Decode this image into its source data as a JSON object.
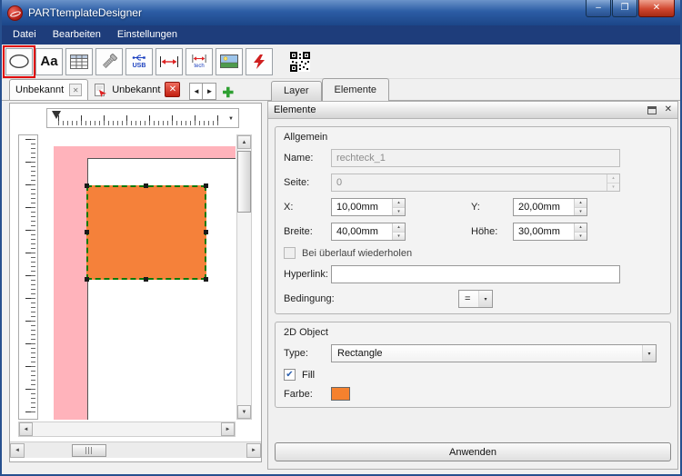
{
  "window": {
    "title": "PARTtemplateDesigner",
    "minimize_glyph": "–",
    "maximize_glyph": "❐",
    "close_glyph": "✕"
  },
  "menubar": {
    "items": [
      "Datei",
      "Bearbeiten",
      "Einstellungen"
    ]
  },
  "toolbar": {
    "text_tool_label": "Aa",
    "usb_label": "USB",
    "tech_label": "tech"
  },
  "doc_tabs": {
    "tab1_label": "Unbekannt",
    "tab2_label": "Unbekannt"
  },
  "panel_tabs": {
    "layer_label": "Layer",
    "elemente_label": "Elemente"
  },
  "dock": {
    "title": "Elemente",
    "allgemein": {
      "title": "Allgemein",
      "name_label": "Name:",
      "name_value": "rechteck_1",
      "seite_label": "Seite:",
      "seite_value": "0",
      "x_label": "X:",
      "x_value": "10,00mm",
      "y_label": "Y:",
      "y_value": "20,00mm",
      "breite_label": "Breite:",
      "breite_value": "40,00mm",
      "hoehe_label": "Höhe:",
      "hoehe_value": "30,00mm",
      "overflow_label": "Bei überlauf wiederholen",
      "hyperlink_label": "Hyperlink:",
      "hyperlink_value": "",
      "bedingung_label": "Bedingung:",
      "bedingung_value": "="
    },
    "object2d": {
      "title": "2D Object",
      "type_label": "Type:",
      "type_value": "Rectangle",
      "fill_label": "Fill",
      "farbe_label": "Farbe:",
      "farbe_color": "#f5812e"
    },
    "apply_label": "Anwenden"
  },
  "canvas": {
    "rect_color": "#f5813a",
    "margin_color": "#ffb3bb"
  },
  "icons": {
    "close": "✕",
    "plus": "✚",
    "check": "✔",
    "arrow_left": "◄",
    "arrow_right": "►",
    "arrow_up": "▲",
    "arrow_down": "▼",
    "spin_up": "▴",
    "spin_down": "▾",
    "combo_arrow": "▾"
  }
}
